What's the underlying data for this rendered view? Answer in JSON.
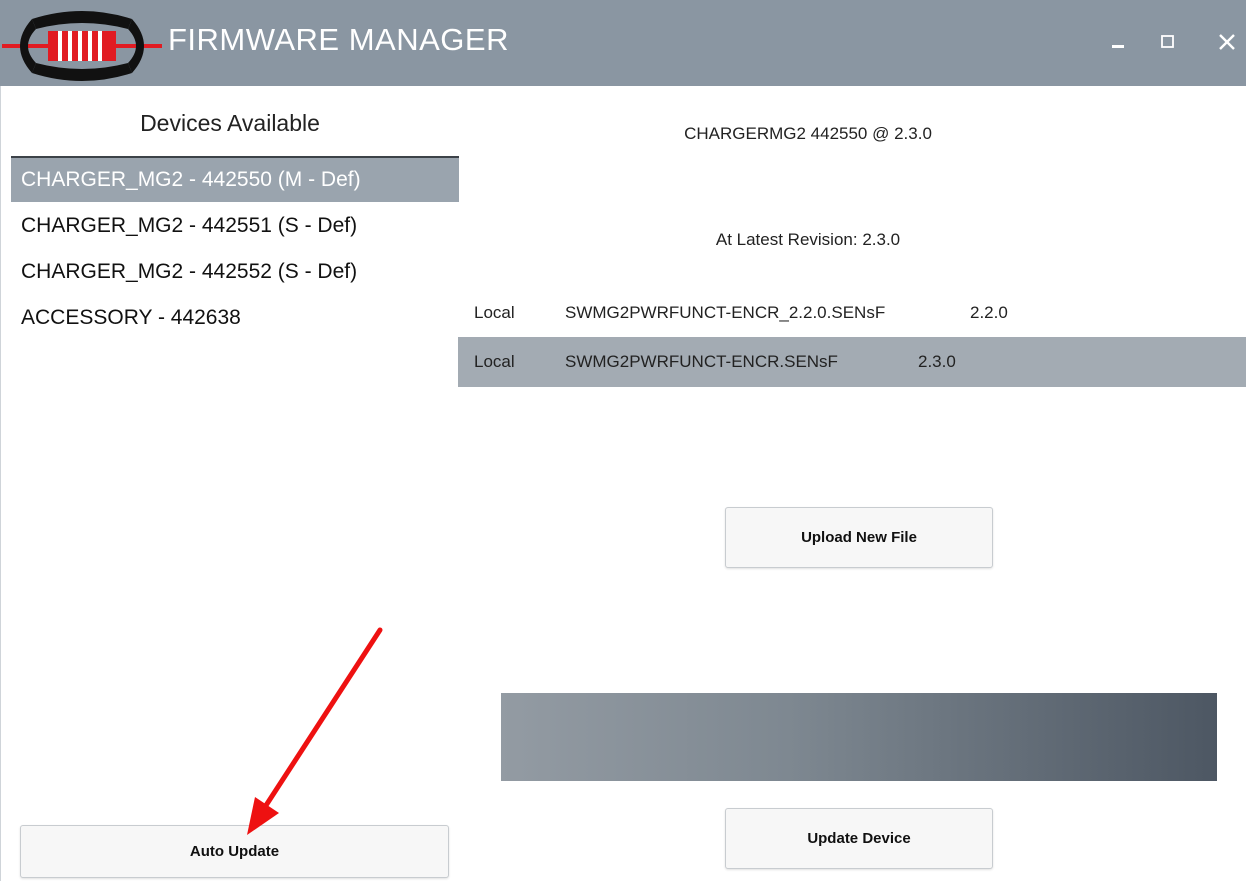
{
  "window": {
    "title": "FIRMWARE MANAGER",
    "controls": {
      "minimize": "minimize-icon",
      "maximize": "maximize-icon",
      "close": "close-icon"
    },
    "titlebar_color": "#8a96a2"
  },
  "devices": {
    "heading": "Devices Available",
    "items": [
      {
        "label": "CHARGER_MG2 - 442550 (M - Def)",
        "selected": true
      },
      {
        "label": "CHARGER_MG2 - 442551 (S - Def)",
        "selected": false
      },
      {
        "label": "CHARGER_MG2 - 442552 (S - Def)",
        "selected": false
      },
      {
        "label": "ACCESSORY - 442638",
        "selected": false
      }
    ],
    "auto_update_label": "Auto Update"
  },
  "details": {
    "device_header": "CHARGERMG2 442550 @ 2.3.0",
    "revision_status": "At Latest Revision: 2.3.0",
    "files": [
      {
        "source": "Local",
        "name": "SWMG2PWRFUNCT-ENCR_2.2.0.SENsF",
        "version": "2.2.0",
        "selected": false
      },
      {
        "source": "Local",
        "name": "SWMG2PWRFUNCT-ENCR.SENsF",
        "version": "2.3.0",
        "selected": true
      }
    ],
    "upload_label": "Upload New File",
    "update_device_label": "Update Device"
  },
  "colors": {
    "selection": "#9aa4ae",
    "annotation_arrow": "#ff0000"
  }
}
